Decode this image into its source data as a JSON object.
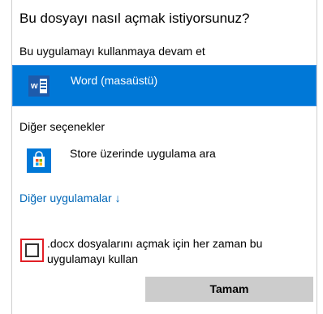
{
  "dialog": {
    "title": "Bu dosyayı nasıl açmak istiyorsunuz?",
    "subtitle": "Bu uygulamayı kullanmaya devam et",
    "current_app": {
      "label": "Word (masaüstü)",
      "icon": "word-app-icon",
      "selected": true
    },
    "other_options_label": "Diğer seçenekler",
    "store_option": {
      "label": "Store üzerinde uygulama ara",
      "icon": "store-bag-icon"
    },
    "more_apps": {
      "label": "Diğer uygulamalar",
      "arrow": "↓"
    },
    "always_use": {
      "line1": ".docx dosyalarını açmak için her zaman bu",
      "line2": "uygulamayı kullan",
      "checked": false
    },
    "ok_label": "Tamam",
    "word_icon_letter": "w"
  },
  "colors": {
    "selection": "#0078d7",
    "link": "#0067b8",
    "highlight_border": "#e11f26",
    "button": "#cccccc"
  }
}
